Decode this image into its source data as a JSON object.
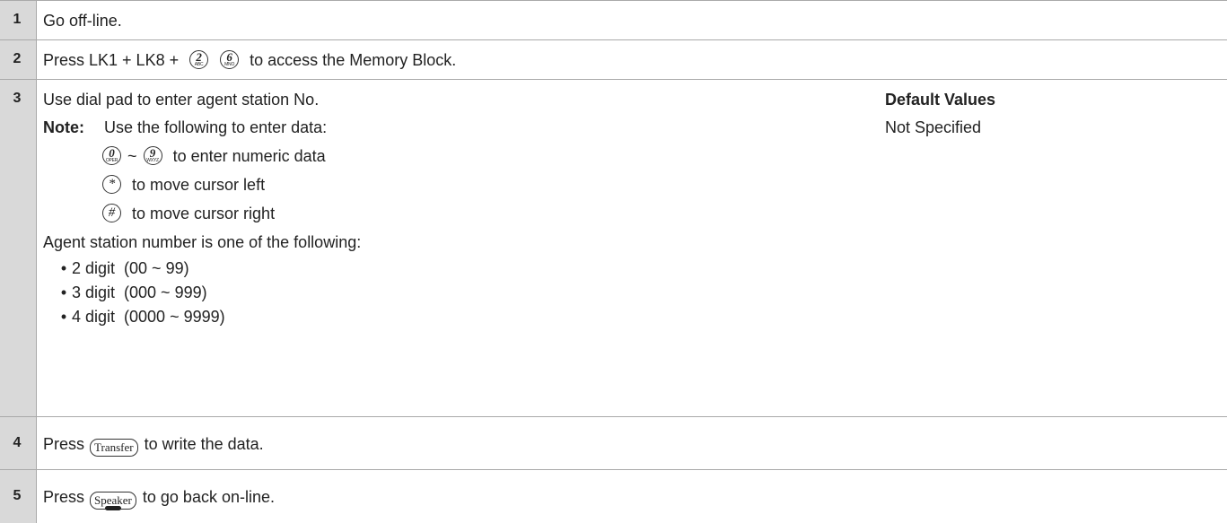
{
  "steps": [
    {
      "num": "1",
      "text": "Go off-line."
    },
    {
      "num": "2",
      "pre": "Press LK1 + LK8 + ",
      "key1_digit": "2",
      "key1_sub": "ABC",
      "key2_digit": "6",
      "key2_sub": "MNO",
      "post": " to access the Memory Block."
    },
    {
      "num": "3",
      "line1": "Use dial pad to enter agent station No.",
      "note_label": "Note:",
      "note_text": "Use the following to enter data:",
      "key0_digit": "0",
      "key0_sub": "OPER",
      "key9_digit": "9",
      "key9_sub": "WXYZ",
      "tilde": "~",
      "numeric_text": " to enter numeric data",
      "star_glyph": "*",
      "star_text": " to move cursor left",
      "hash_glyph": "#",
      "hash_text": " to move cursor right",
      "agent_text": "Agent station number is one of the following:",
      "bullets": [
        "2 digit  (00 ~ 99)",
        "3 digit  (000 ~ 999)",
        "4 digit  (0000 ~ 9999)"
      ],
      "default_label": "Default Values",
      "default_value": "Not Specified"
    },
    {
      "num": "4",
      "pre": "Press ",
      "key_label": "Transfer",
      "post": " to write the data."
    },
    {
      "num": "5",
      "pre": "Press ",
      "key_label": "Speaker",
      "post": " to go back on-line."
    }
  ]
}
